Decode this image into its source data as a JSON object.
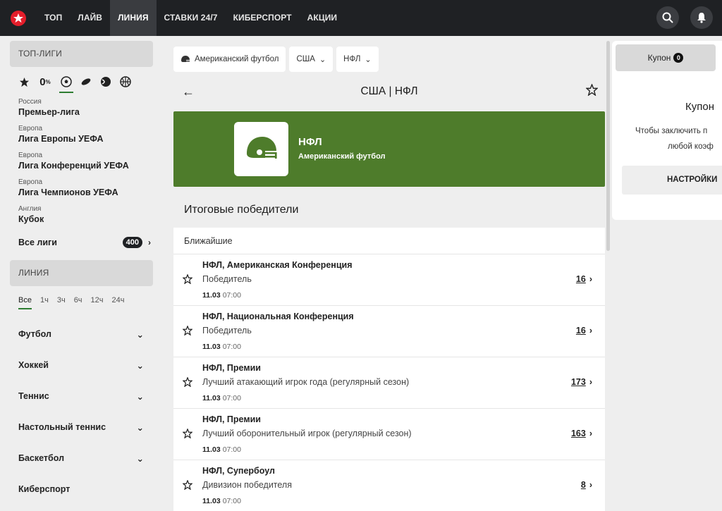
{
  "nav": {
    "items": [
      "ТОП",
      "ЛАЙВ",
      "ЛИНИЯ",
      "СТАВКИ 24/7",
      "КИБЕРСПОРТ",
      "АКЦИИ"
    ],
    "active": "ЛИНИЯ"
  },
  "sidebar": {
    "top_leagues_header": "ТОП-ЛИГИ",
    "zero_label": "0",
    "leagues": [
      {
        "country": "Россия",
        "name": "Премьер-лига"
      },
      {
        "country": "Европа",
        "name": "Лига Европы УЕФА"
      },
      {
        "country": "Европа",
        "name": "Лига Конференций УЕФА"
      },
      {
        "country": "Европа",
        "name": "Лига Чемпионов УЕФА"
      },
      {
        "country": "Англия",
        "name": "Кубок"
      }
    ],
    "all_leagues_label": "Все лиги",
    "all_leagues_count": "400",
    "line_header": "ЛИНИЯ",
    "time_filters": [
      "Все",
      "1ч",
      "3ч",
      "6ч",
      "12ч",
      "24ч"
    ],
    "sports": [
      "Футбол",
      "Хоккей",
      "Теннис",
      "Настольный теннис",
      "Баскетбол",
      "Киберспорт"
    ]
  },
  "main": {
    "filters": [
      "Американский футбол",
      "США",
      "НФЛ"
    ],
    "title": "США | НФЛ",
    "banner": {
      "name": "НФЛ",
      "sport": "Американский футбол",
      "color": "#4e7c2b"
    },
    "section_title": "Итоговые победители",
    "list_header": "Ближайшие",
    "events": [
      {
        "name": "НФЛ, Американская Конференция",
        "market": "Победитель",
        "date": "11.03",
        "time": "07:00",
        "count": "16"
      },
      {
        "name": "НФЛ, Национальная Конференция",
        "market": "Победитель",
        "date": "11.03",
        "time": "07:00",
        "count": "16"
      },
      {
        "name": "НФЛ, Премии",
        "market": "Лучший атакающий игрок года (регулярный сезон)",
        "date": "11.03",
        "time": "07:00",
        "count": "173"
      },
      {
        "name": "НФЛ, Премии",
        "market": "Лучший оборонительный игрок (регулярный сезон)",
        "date": "11.03",
        "time": "07:00",
        "count": "163"
      },
      {
        "name": "НФЛ, Супербоул",
        "market": "Дивизион победителя",
        "date": "11.03",
        "time": "07:00",
        "count": "8"
      }
    ]
  },
  "coupon": {
    "tab_label": "Купон",
    "tab_count": "0",
    "title": "Купон",
    "text_line1": "Чтобы заключить п",
    "text_line2": "любой коэф",
    "button": "НАСТРОЙКИ"
  }
}
